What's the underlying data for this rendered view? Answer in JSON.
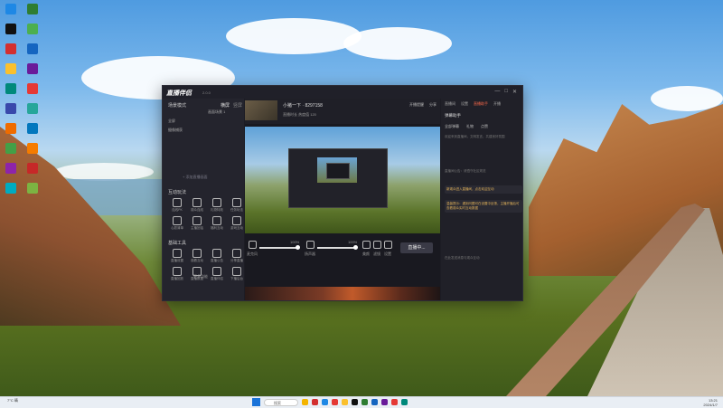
{
  "desktop": {
    "icon_colors": [
      "#1e88e5",
      "#2e7d32",
      "#111111",
      "#4caf50",
      "#d32f2f",
      "#1565c0",
      "#fbc02d",
      "#6a1b9a",
      "#00897b",
      "#e53935",
      "#3949ab",
      "#26a69a",
      "#ef6c00",
      "#0277bd",
      "#43a047",
      "#f57c00",
      "#8e24aa",
      "#c62828",
      "#00acc1",
      "#7cb342"
    ]
  },
  "app": {
    "logo": "直播伴侣",
    "version": "2.0.0",
    "window_controls": [
      "—",
      "□",
      "✕"
    ],
    "left": {
      "scene_header": "场景模式",
      "scene_tab_a": "横屏",
      "scene_tab_b": "竖屏",
      "scene_rows": [
        "画面场景 1",
        "全屏",
        "摄像捕获"
      ],
      "add_source": "+ 添加直播画面",
      "interactive_title": "互动玩法",
      "interactive_tools": [
        "连线PK",
        "观众连线",
        "礼物特效",
        "任务玩法",
        "心愿清单",
        "主播回话",
        "福利互动",
        "游戏互动"
      ],
      "utility_title": "基础工具",
      "utility_tools": [
        "直播设置",
        "观看互动",
        "直播公告",
        "分享直播",
        "直播回放",
        "直播数据",
        "直播伴侣",
        "下播后台"
      ],
      "more_button": "更多功能"
    },
    "center": {
      "profile_name": "小猪一下 · 8297158",
      "profile_stats": "直播时长  热度值 120",
      "top_actions": [
        "开播提醒",
        "分享"
      ],
      "mic_label": "麦克风",
      "mic_value": "100%",
      "speaker_label": "扬声器",
      "speaker_value": "100%",
      "control_labels": [
        "美颜",
        "滤镜",
        "设置"
      ],
      "start_button": "直播中..."
    },
    "right": {
      "tabs": [
        "直播间",
        "设置",
        "直播助手",
        "开播"
      ],
      "panel_title": "弹幕助手",
      "panel_tabs": [
        "全部弹幕",
        "礼物",
        "点赞"
      ],
      "msg1": "欢迎来到直播间，文明发言，共建良好氛围",
      "msg2": "直播间公告：请遵守社区规范",
      "msg3": "新观众进入直播间，点击欢迎互动",
      "msg4": "温馨提示：遇到问题可在设置中反馈，主播开播后可查看观众实时互动数据",
      "bottom_hint": "在此发送消息与观众互动"
    }
  },
  "taskbar": {
    "weather": "7°C 晴",
    "search_placeholder": "搜索",
    "time": "13:21",
    "date": "2024/1/7",
    "app_colors": [
      "#f4b400",
      "#d32f2f",
      "#1e88e5",
      "#e53935",
      "#fbc02d",
      "#111111",
      "#2e7d32",
      "#1565c0",
      "#6a1b9a",
      "#e53935",
      "#00897b"
    ]
  }
}
